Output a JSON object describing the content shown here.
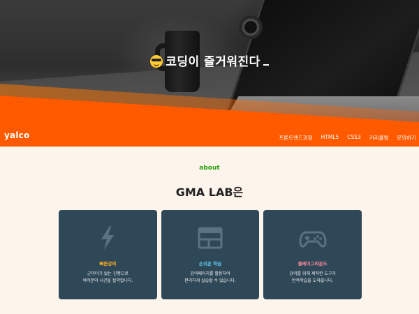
{
  "hero": {
    "title": "코딩이 즐거워진다",
    "emoji": "sunglasses-emoji"
  },
  "header": {
    "logo": "yalco",
    "nav": [
      "프론트엔드과정",
      "HTML5",
      "CSS3",
      "커리큘럼",
      "문의하기"
    ]
  },
  "about": {
    "tag": "about",
    "title": "GMA LAB은"
  },
  "cards": [
    {
      "icon": "lightning-icon",
      "title": "빠른강의",
      "desc_line1": "군더더기 없는 진행으로",
      "desc_line2": "여러분의 시간을 절약합니다."
    },
    {
      "icon": "layout-icon",
      "title": "손쉬운 학습",
      "desc_line1": "강의페이지를 활용하여",
      "desc_line2": "편리하게 실습할 수 있습니다."
    },
    {
      "icon": "gamepad-icon",
      "title": "플레이그라운드",
      "desc_line1": "강의를 위해 제작한 도구가",
      "desc_line2": "반복학습을 도와줍니다."
    }
  ],
  "colors": {
    "accent": "#ff5a00",
    "about_tag": "#22a30a",
    "card_bg": "#2f4858",
    "card1_title": "#ffb020",
    "card2_title": "#5ec8f0",
    "card3_title": "#ff8a9a"
  }
}
